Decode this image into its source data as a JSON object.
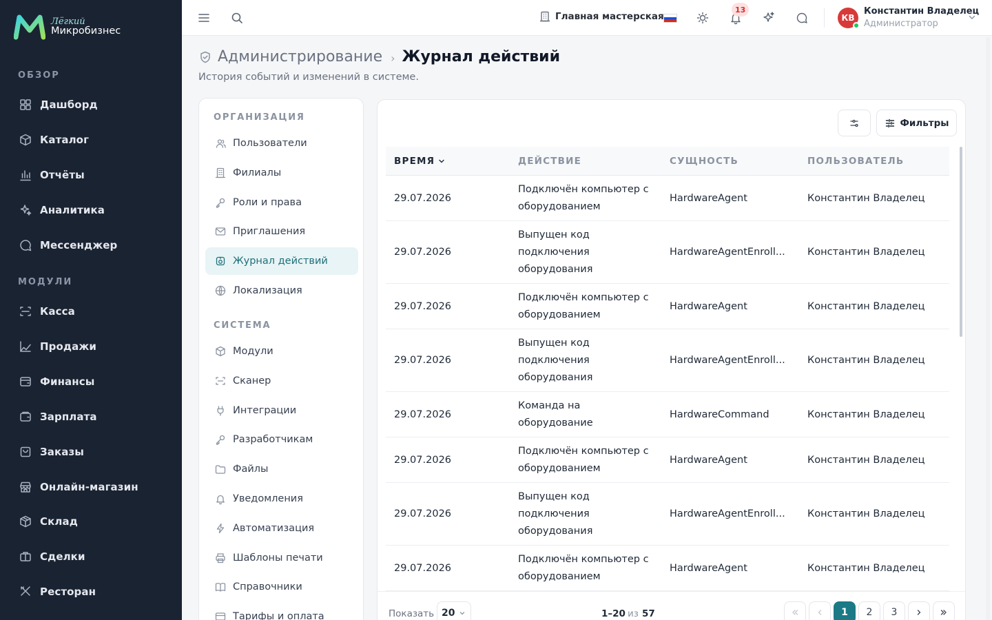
{
  "brand": {
    "top": "Лёгкий",
    "bottom": "Микробизнес"
  },
  "sidebar": {
    "sections": [
      "ОБЗОР",
      "МОДУЛИ"
    ],
    "overview": [
      {
        "label": "Дашборд",
        "icon": "dashboard-icon"
      },
      {
        "label": "Каталог",
        "icon": "catalog-icon"
      },
      {
        "label": "Отчёты",
        "icon": "reports-icon"
      },
      {
        "label": "Аналитика",
        "icon": "analytics-icon"
      },
      {
        "label": "Мессенджер",
        "icon": "messenger-icon"
      }
    ],
    "modules": [
      {
        "label": "Касса",
        "icon": "cashbox-icon"
      },
      {
        "label": "Продажи",
        "icon": "sales-icon"
      },
      {
        "label": "Финансы",
        "icon": "finance-icon"
      },
      {
        "label": "Зарплата",
        "icon": "salary-icon"
      },
      {
        "label": "Заказы",
        "icon": "orders-icon"
      },
      {
        "label": "Онлайн-магазин",
        "icon": "store-icon"
      },
      {
        "label": "Склад",
        "icon": "warehouse-icon"
      },
      {
        "label": "Сделки",
        "icon": "deals-icon"
      },
      {
        "label": "Ресторан",
        "icon": "restaurant-icon"
      }
    ]
  },
  "topbar": {
    "branch": "Главная мастерская",
    "notifications_count": "13",
    "user": {
      "initials": "КВ",
      "name": "Константин Владелец",
      "role": "Администратор"
    }
  },
  "page": {
    "breadcrumb_parent": "Администрирование",
    "breadcrumb_sep": "›",
    "title": "Журнал действий",
    "subtitle": "История событий и изменений в системе."
  },
  "subnav": {
    "sections": [
      "ОРГАНИЗАЦИЯ",
      "СИСТЕМА"
    ],
    "org": [
      {
        "label": "Пользователи",
        "icon": "users-icon"
      },
      {
        "label": "Филиалы",
        "icon": "building-icon"
      },
      {
        "label": "Роли и права",
        "icon": "key-icon"
      },
      {
        "label": "Приглашения",
        "icon": "mail-icon"
      },
      {
        "label": "Журнал действий",
        "icon": "audit-log-icon",
        "active": true
      },
      {
        "label": "Локализация",
        "icon": "globe-icon"
      }
    ],
    "system": [
      {
        "label": "Модули",
        "icon": "module-icon"
      },
      {
        "label": "Сканер",
        "icon": "scanner-icon"
      },
      {
        "label": "Интеграции",
        "icon": "plug-icon"
      },
      {
        "label": "Разработчикам",
        "icon": "dev-key-icon"
      },
      {
        "label": "Файлы",
        "icon": "folder-icon"
      },
      {
        "label": "Уведомления",
        "icon": "bell-icon"
      },
      {
        "label": "Автоматизация",
        "icon": "bolt-icon"
      },
      {
        "label": "Шаблоны печати",
        "icon": "printer-icon"
      },
      {
        "label": "Справочники",
        "icon": "book-icon"
      },
      {
        "label": "Тарифы и оплата",
        "icon": "card-icon"
      }
    ]
  },
  "toolbar": {
    "filters_label": "Фильтры"
  },
  "table": {
    "columns": [
      "ВРЕМЯ",
      "ДЕЙСТВИЕ",
      "СУЩНОСТЬ",
      "ПОЛЬЗОВАТЕЛЬ"
    ],
    "rows": [
      {
        "time": "29.07.2026",
        "action": [
          "Подключён компьютер с",
          "оборудованием"
        ],
        "entity": "HardwareAgent",
        "user": "Константин Владелец"
      },
      {
        "time": "29.07.2026",
        "action": [
          "Выпущен код",
          "подключения",
          "оборудования"
        ],
        "entity": "HardwareAgentEnroll...",
        "user": "Константин Владелец"
      },
      {
        "time": "29.07.2026",
        "action": [
          "Подключён компьютер с",
          "оборудованием"
        ],
        "entity": "HardwareAgent",
        "user": "Константин Владелец"
      },
      {
        "time": "29.07.2026",
        "action": [
          "Выпущен код",
          "подключения",
          "оборудования"
        ],
        "entity": "HardwareAgentEnroll...",
        "user": "Константин Владелец"
      },
      {
        "time": "29.07.2026",
        "action": [
          "Команда на",
          "оборудование"
        ],
        "entity": "HardwareCommand",
        "user": "Константин Владелец"
      },
      {
        "time": "29.07.2026",
        "action": [
          "Подключён компьютер с",
          "оборудованием"
        ],
        "entity": "HardwareAgent",
        "user": "Константин Владелец"
      },
      {
        "time": "29.07.2026",
        "action": [
          "Выпущен код",
          "подключения",
          "оборудования"
        ],
        "entity": "HardwareAgentEnroll...",
        "user": "Константин Владелец"
      },
      {
        "time": "29.07.2026",
        "action": [
          "Подключён компьютер с",
          "оборудованием"
        ],
        "entity": "HardwareAgent",
        "user": "Константин Владелец"
      }
    ]
  },
  "pagination": {
    "show_label": "Показать",
    "page_size": "20",
    "range": "1–20",
    "of_label": "из",
    "total": "57",
    "pages": [
      "1",
      "2",
      "3"
    ],
    "current": "1"
  },
  "colors": {
    "sidebar_bg": "#1a2332",
    "accent": "#1b7a86",
    "badge": "#d63030"
  }
}
